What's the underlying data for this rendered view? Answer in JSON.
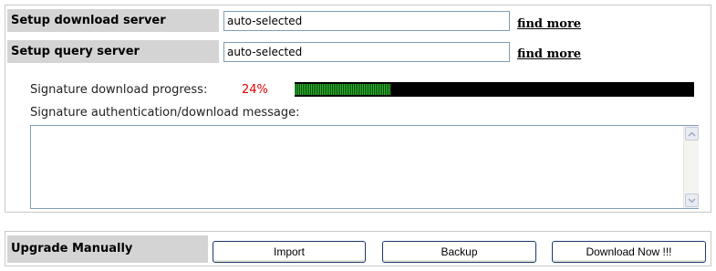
{
  "download_server": {
    "label": "Setup download server",
    "value": "auto-selected",
    "link": "find more"
  },
  "query_server": {
    "label": "Setup query server",
    "value": "auto-selected",
    "link": "find more"
  },
  "progress": {
    "label": "Signature download progress:",
    "percent_text": "24%",
    "fraction": 0.24,
    "percent_color": "#e00000",
    "bar_fill_color": "#2fb52f",
    "bar_track_color": "#000000"
  },
  "message": {
    "label": "Signature authentication/download message:",
    "content": ""
  },
  "upgrade": {
    "label": "Upgrade Manually",
    "import_label": "Import",
    "backup_label": "Backup",
    "download_label": "Download Now !!!"
  },
  "icons": {
    "scroll_up": "chevron-up-icon",
    "scroll_down": "chevron-down-icon"
  }
}
